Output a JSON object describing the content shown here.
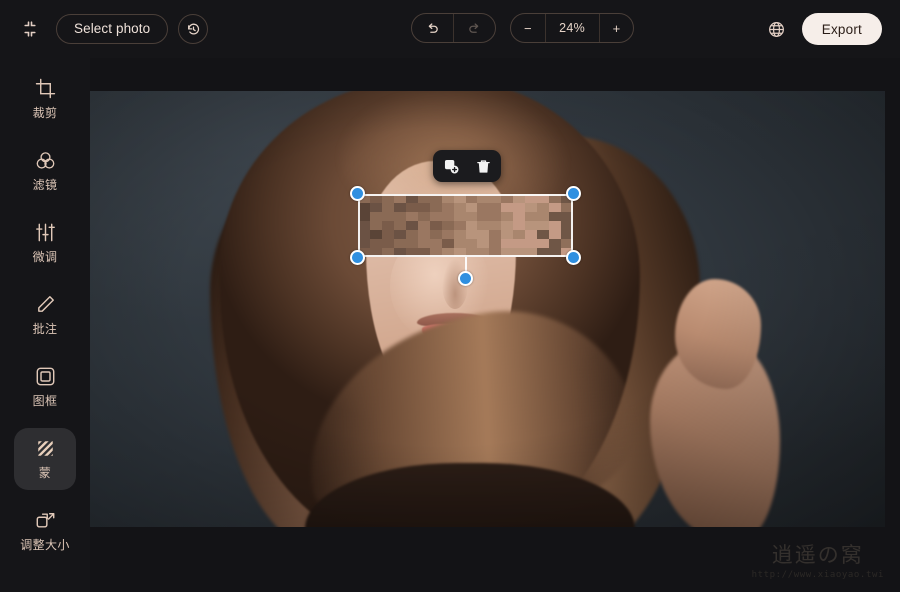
{
  "topbar": {
    "collapse_icon": "collapse-corners-icon",
    "select_photo_label": "Select photo",
    "history_icon": "history-revert-icon",
    "undo_icon": "undo-arrow-icon",
    "redo_icon": "redo-arrow-icon",
    "zoom_out_label": "−",
    "zoom_level": "24%",
    "zoom_in_label": "+",
    "language_icon": "globe-icon",
    "export_label": "Export"
  },
  "sidebar": {
    "items": [
      {
        "label": "裁剪",
        "icon": "crop-icon",
        "active": false
      },
      {
        "label": "滤镜",
        "icon": "filter-rings-icon",
        "active": false
      },
      {
        "label": "微调",
        "icon": "sliders-icon",
        "active": false
      },
      {
        "label": "批注",
        "icon": "pencil-icon",
        "active": false
      },
      {
        "label": "图框",
        "icon": "frame-icon",
        "active": false
      },
      {
        "label": "蒙",
        "icon": "mosaic-icon",
        "active": true
      },
      {
        "label": "调整大小",
        "icon": "resize-icon",
        "active": false
      }
    ]
  },
  "canvas": {
    "photo_alt": "portrait-photo",
    "selection": {
      "tool": "mosaic-region",
      "handles": [
        "top-left",
        "top-right",
        "bottom-left",
        "bottom-right",
        "rotate"
      ],
      "handle_color": "#2f8fe0",
      "frame_color": "#ffffff"
    },
    "mini_toolbar": {
      "duplicate_icon": "duplicate-icon",
      "delete_icon": "trash-icon"
    }
  },
  "watermark": {
    "title": "逍遥の窝",
    "url": "http://www.xiaoyao.twi"
  },
  "colors": {
    "app_bg": "#131316",
    "panel_bg": "#151518",
    "accent_text": "#e3cfc4",
    "active_item_bg": "#2e2e31",
    "export_bg": "#f6eee9",
    "handle_blue": "#2f8fe0"
  }
}
